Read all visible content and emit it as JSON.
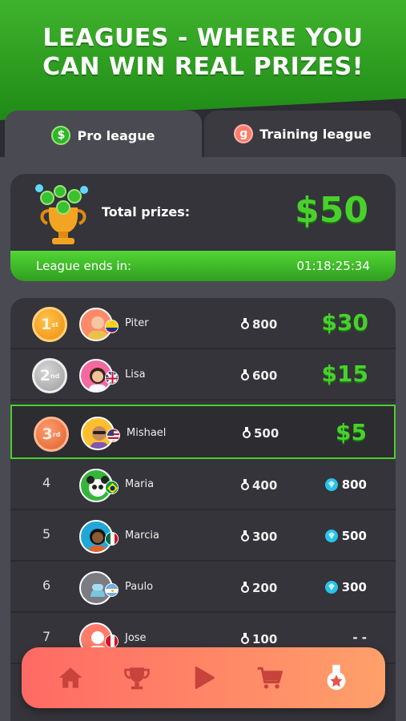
{
  "headline": {
    "line1": "LEAGUES - WHERE YOU",
    "line2": "CAN WIN REAL PRIZES!"
  },
  "tabs": [
    {
      "label": "Pro league",
      "icon": "dollar-coin-icon",
      "active": true
    },
    {
      "label": "Training league",
      "icon": "training-coin-icon",
      "active": false
    }
  ],
  "prizes": {
    "label": "Total prizes:",
    "amount": "$50"
  },
  "league_timer": {
    "label": "League ends in:",
    "time": "01:18:25:34"
  },
  "leaderboard": [
    {
      "rank": "1",
      "rank_suffix": "st",
      "name": "Piter",
      "score": "800",
      "prize": "$30",
      "prize_type": "cash"
    },
    {
      "rank": "2",
      "rank_suffix": "nd",
      "name": "Lisa",
      "score": "600",
      "prize": "$15",
      "prize_type": "cash"
    },
    {
      "rank": "3",
      "rank_suffix": "rd",
      "name": "Mishael",
      "score": "500",
      "prize": "$5",
      "prize_type": "cash",
      "highlighted": true
    },
    {
      "rank": "4",
      "name": "Maria",
      "score": "400",
      "prize": "800",
      "prize_type": "gems"
    },
    {
      "rank": "5",
      "name": "Marcia",
      "score": "300",
      "prize": "500",
      "prize_type": "gems"
    },
    {
      "rank": "6",
      "name": "Paulo",
      "score": "200",
      "prize": "300",
      "prize_type": "gems"
    },
    {
      "rank": "7",
      "name": "Jose",
      "score": "100",
      "prize": "- -",
      "prize_type": "none"
    }
  ],
  "nav": [
    {
      "icon": "home-icon"
    },
    {
      "icon": "trophy-icon"
    },
    {
      "icon": "play-icon"
    },
    {
      "icon": "cart-icon"
    },
    {
      "icon": "medal-icon"
    }
  ],
  "colors": {
    "accent_green": "#49d02d",
    "banner_green": "#2fa824",
    "nav_gradient_start": "#ff6a64",
    "nav_gradient_end": "#ffa06a"
  }
}
